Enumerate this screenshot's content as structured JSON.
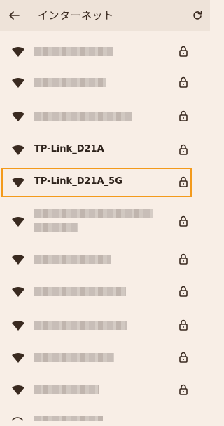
{
  "header": {
    "title": "インターネット",
    "back_icon": "arrow-left-icon",
    "refresh_icon": "refresh-icon"
  },
  "networks": [
    {
      "ssid": "",
      "obscured": true,
      "secured": true
    },
    {
      "ssid": "",
      "obscured": true,
      "secured": true
    },
    {
      "ssid": "",
      "obscured": true,
      "secured": true
    },
    {
      "ssid": "TP-Link_D21A",
      "obscured": false,
      "secured": true
    },
    {
      "ssid": "TP-Link_D21A_5G",
      "obscured": false,
      "secured": true,
      "highlighted": true
    },
    {
      "ssid": "",
      "obscured": true,
      "secured": true
    },
    {
      "ssid": "",
      "obscured": true,
      "secured": true
    },
    {
      "ssid": "",
      "obscured": true,
      "secured": true
    },
    {
      "ssid": "",
      "obscured": true,
      "secured": true
    },
    {
      "ssid": "",
      "obscured": true,
      "secured": true
    },
    {
      "ssid": "",
      "obscured": true,
      "secured": true
    }
  ],
  "colors": {
    "background": "#f8eee6",
    "appbar": "#eee3d9",
    "highlight": "#f39a1c",
    "icon": "#3a2a20"
  }
}
